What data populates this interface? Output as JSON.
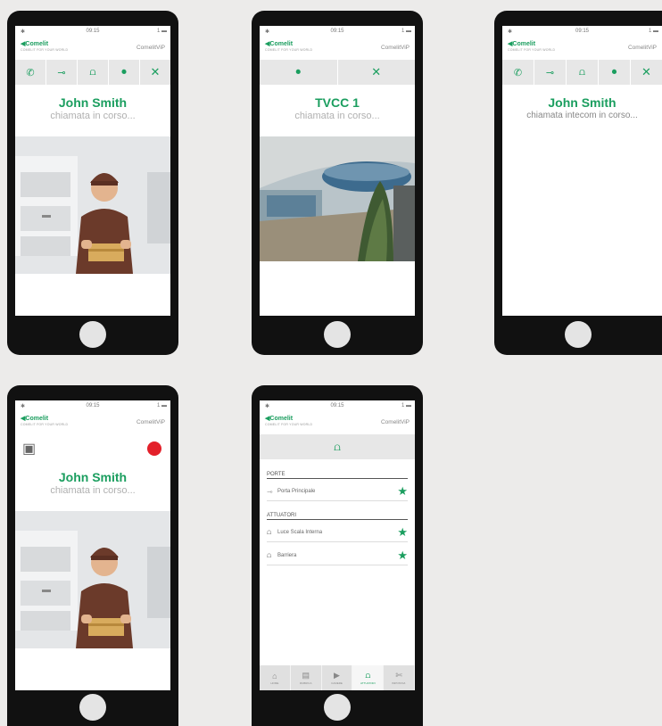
{
  "status": {
    "signal": "✱",
    "time": "09:15",
    "battery": "1 ▬"
  },
  "brand": {
    "logo": "◀Comelit",
    "tagline": "COMELIT FOR YOUR WORLD",
    "app": "ComelitViP"
  },
  "icons": {
    "phone": "✆",
    "key": "⊸",
    "actuator": "⩍",
    "cctv": "⏺",
    "close": "✕",
    "camera": "▣",
    "record": "●",
    "star": "★",
    "arrow": "⇾",
    "act_row": "⩍"
  },
  "colors": {
    "accent": "#1b9e5f",
    "record": "#e3202a"
  },
  "screens": [
    {
      "caller": "John Smith",
      "status": "chiamata in corso..."
    },
    {
      "caller": "TVCC 1",
      "status": "chiamata in corso..."
    },
    {
      "caller": "John Smith",
      "status": "chiamata intecom in corso..."
    },
    {
      "caller": "John Smith",
      "status": "chiamata in corso..."
    }
  ],
  "actuators": {
    "section_porte": "PORTE",
    "porte_items": [
      {
        "label": "Porta Principale"
      }
    ],
    "section_attuatori": "ATTUATORI",
    "attuatori_items": [
      {
        "label": "Luce Scala Interna"
      },
      {
        "label": "Barriera"
      }
    ],
    "tabs": [
      {
        "label": "HOME",
        "icon": "⌂"
      },
      {
        "label": "RUBRICA",
        "icon": "▤"
      },
      {
        "label": "CAMERE",
        "icon": "▶"
      },
      {
        "label": "ATTUATORI",
        "icon": "⩍"
      },
      {
        "label": "IMPOSTAZ.",
        "icon": "✄"
      }
    ]
  }
}
